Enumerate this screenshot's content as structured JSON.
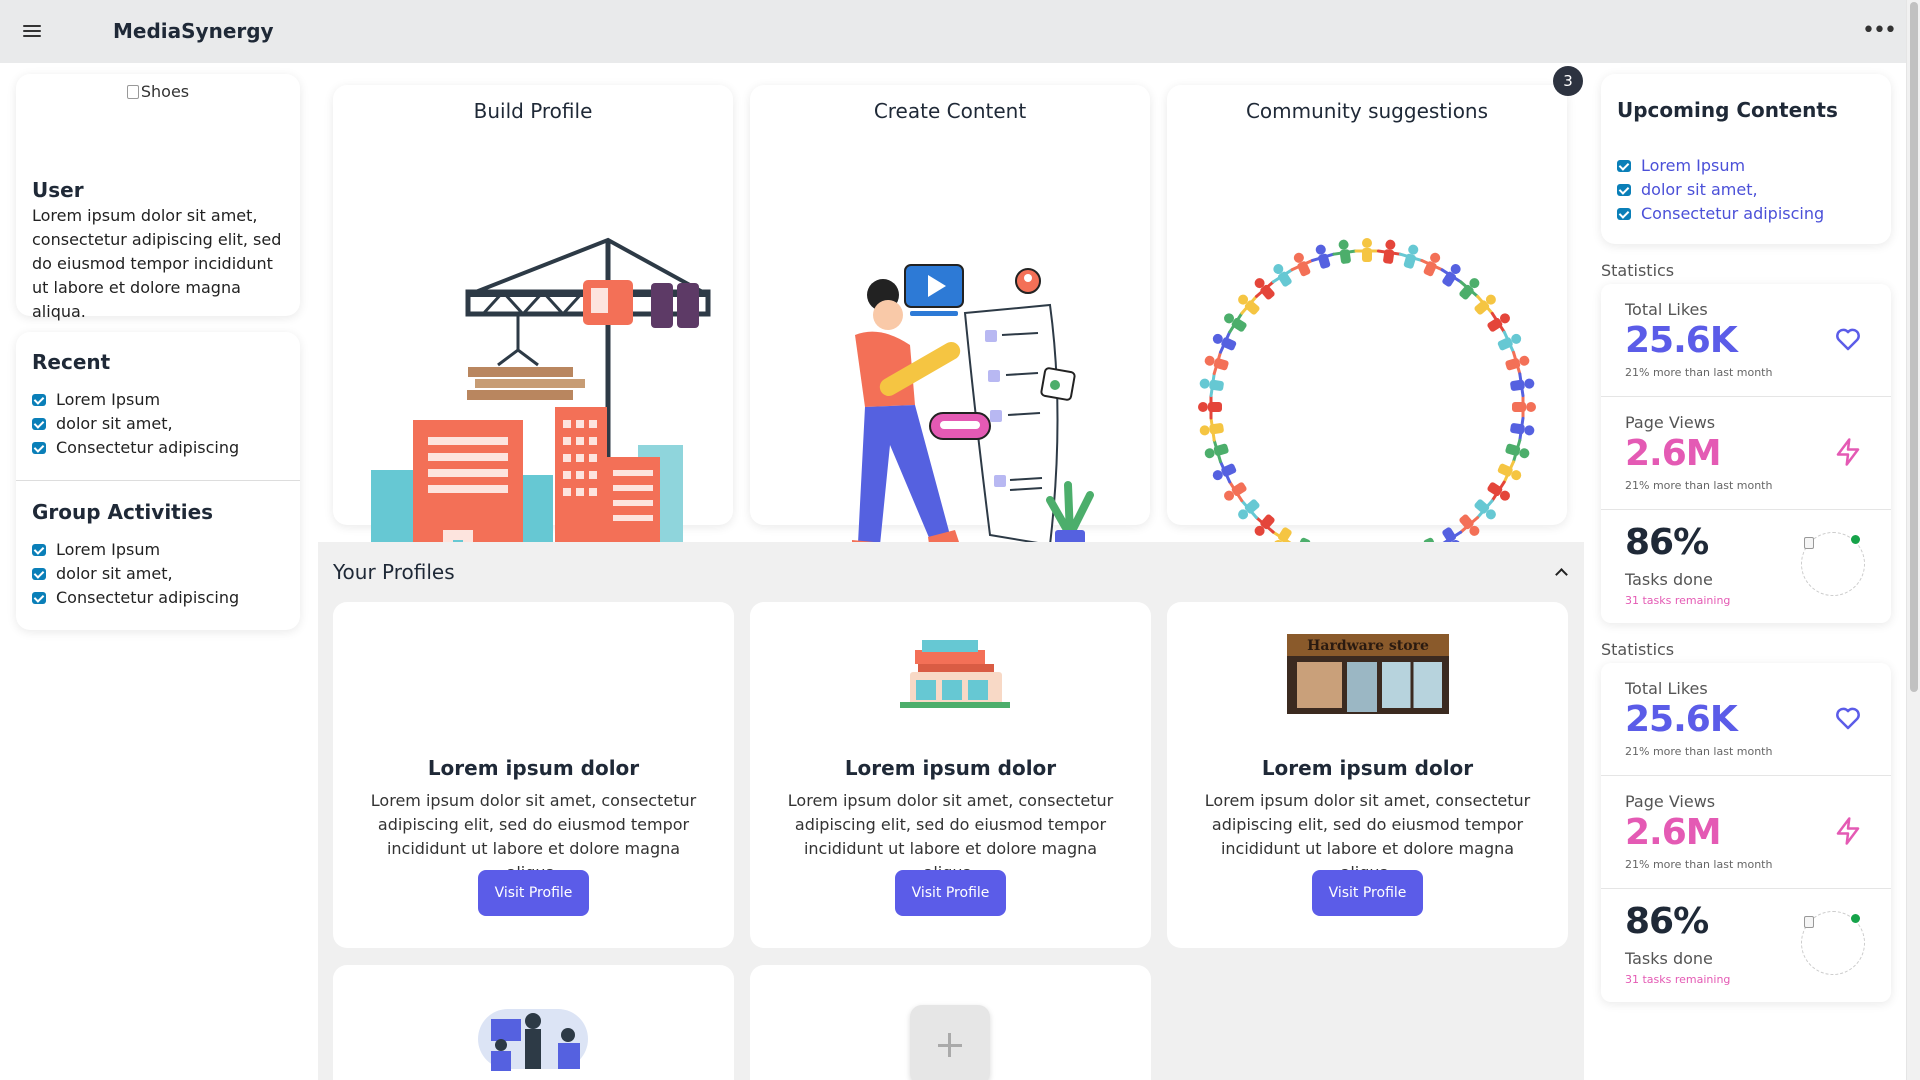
{
  "header": {
    "title": "MediaSynergy"
  },
  "user_card": {
    "image_alt": "Shoes",
    "title": "User",
    "text": "Lorem ipsum dolor sit amet, consectetur adipiscing elit, sed do eiusmod tempor incididunt ut labore et dolore magna aliqua."
  },
  "recent": {
    "title": "Recent",
    "items": [
      "Lorem Ipsum",
      "dolor sit amet,",
      "Consectetur adipiscing"
    ]
  },
  "group_activities": {
    "title": "Group Activities",
    "items": [
      "Lorem Ipsum",
      "dolor sit amet,",
      "Consectetur adipiscing"
    ]
  },
  "hero_cards": [
    {
      "title": "Build Profile",
      "illustration": "construction-crane-illustration"
    },
    {
      "title": "Create Content",
      "illustration": "content-creator-illustration"
    },
    {
      "title": "Community suggestions",
      "illustration": "people-circle-illustration"
    }
  ],
  "notification_badge": "3",
  "profiles": {
    "title": "Your Profiles",
    "cards": [
      {
        "title": "Lorem ipsum dolor",
        "text": "Lorem ipsum dolor sit amet, consectetur adipiscing elit, sed do eiusmod tempor incididunt ut labore et dolore magna aliqua.",
        "button": "Visit Profile"
      },
      {
        "title": "Lorem ipsum dolor",
        "text": "Lorem ipsum dolor sit amet, consectetur adipiscing elit, sed do eiusmod tempor incididunt ut labore et dolore magna aliqua.",
        "button": "Visit Profile"
      },
      {
        "title": "Lorem ipsum dolor",
        "text": "Lorem ipsum dolor sit amet, consectetur adipiscing elit, sed do eiusmod tempor incididunt ut labore et dolore magna aliqua.",
        "button": "Visit Profile",
        "store_sign": "Hardware store"
      }
    ]
  },
  "upcoming": {
    "title": "Upcoming Contents",
    "items": [
      "Lorem Ipsum",
      "dolor sit amet,",
      "Consectetur adipiscing"
    ]
  },
  "statistics": [
    {
      "label": "Statistics",
      "likes": {
        "title": "Total Likes",
        "value": "25.6K",
        "desc": "21% more than last month"
      },
      "views": {
        "title": "Page Views",
        "value": "2.6M",
        "desc": "21% more than last month"
      },
      "tasks": {
        "value": "86%",
        "title": "Tasks done",
        "desc": "31 tasks remaining"
      }
    },
    {
      "label": "Statistics",
      "likes": {
        "title": "Total Likes",
        "value": "25.6K",
        "desc": "21% more than last month"
      },
      "views": {
        "title": "Page Views",
        "value": "2.6M",
        "desc": "21% more than last month"
      },
      "tasks": {
        "value": "86%",
        "title": "Tasks done",
        "desc": "31 tasks remaining"
      }
    }
  ],
  "colors": {
    "primary": "#5b5ce8",
    "pink": "#e45ab4",
    "check": "#0a7fb8",
    "topbar": "#e9eaeb"
  }
}
